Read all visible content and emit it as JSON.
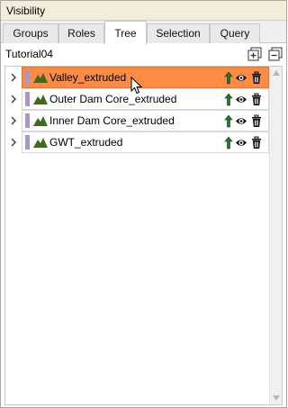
{
  "panel": {
    "title": "Visibility"
  },
  "tabs": [
    {
      "label": "Groups",
      "active": false
    },
    {
      "label": "Roles",
      "active": false
    },
    {
      "label": "Tree",
      "active": true
    },
    {
      "label": "Selection",
      "active": false
    },
    {
      "label": "Query",
      "active": false
    }
  ],
  "toolbar": {
    "project_name": "Tutorial04",
    "icons": [
      "expand-all-icon",
      "collapse-all-icon"
    ]
  },
  "tree": {
    "items": [
      {
        "label": "Valley_extruded",
        "selected": true,
        "color": "#a997c9"
      },
      {
        "label": "Outer Dam Core_extruded",
        "selected": false,
        "color": "#a997c9"
      },
      {
        "label": "Inner Dam Core_extruded",
        "selected": false,
        "color": "#a997c9"
      },
      {
        "label": "GWT_extruded",
        "selected": false,
        "color": "#a997c9"
      }
    ],
    "row_actions": [
      "arrow-up-icon",
      "eye-icon",
      "trash-icon"
    ]
  },
  "colors": {
    "title_bg": "#f3ecd9",
    "selected_row": "#fc8b44",
    "swatch": "#a997c9",
    "layer_icon": "#3e6b1f",
    "arrow_icon": "#1f7a2d"
  }
}
